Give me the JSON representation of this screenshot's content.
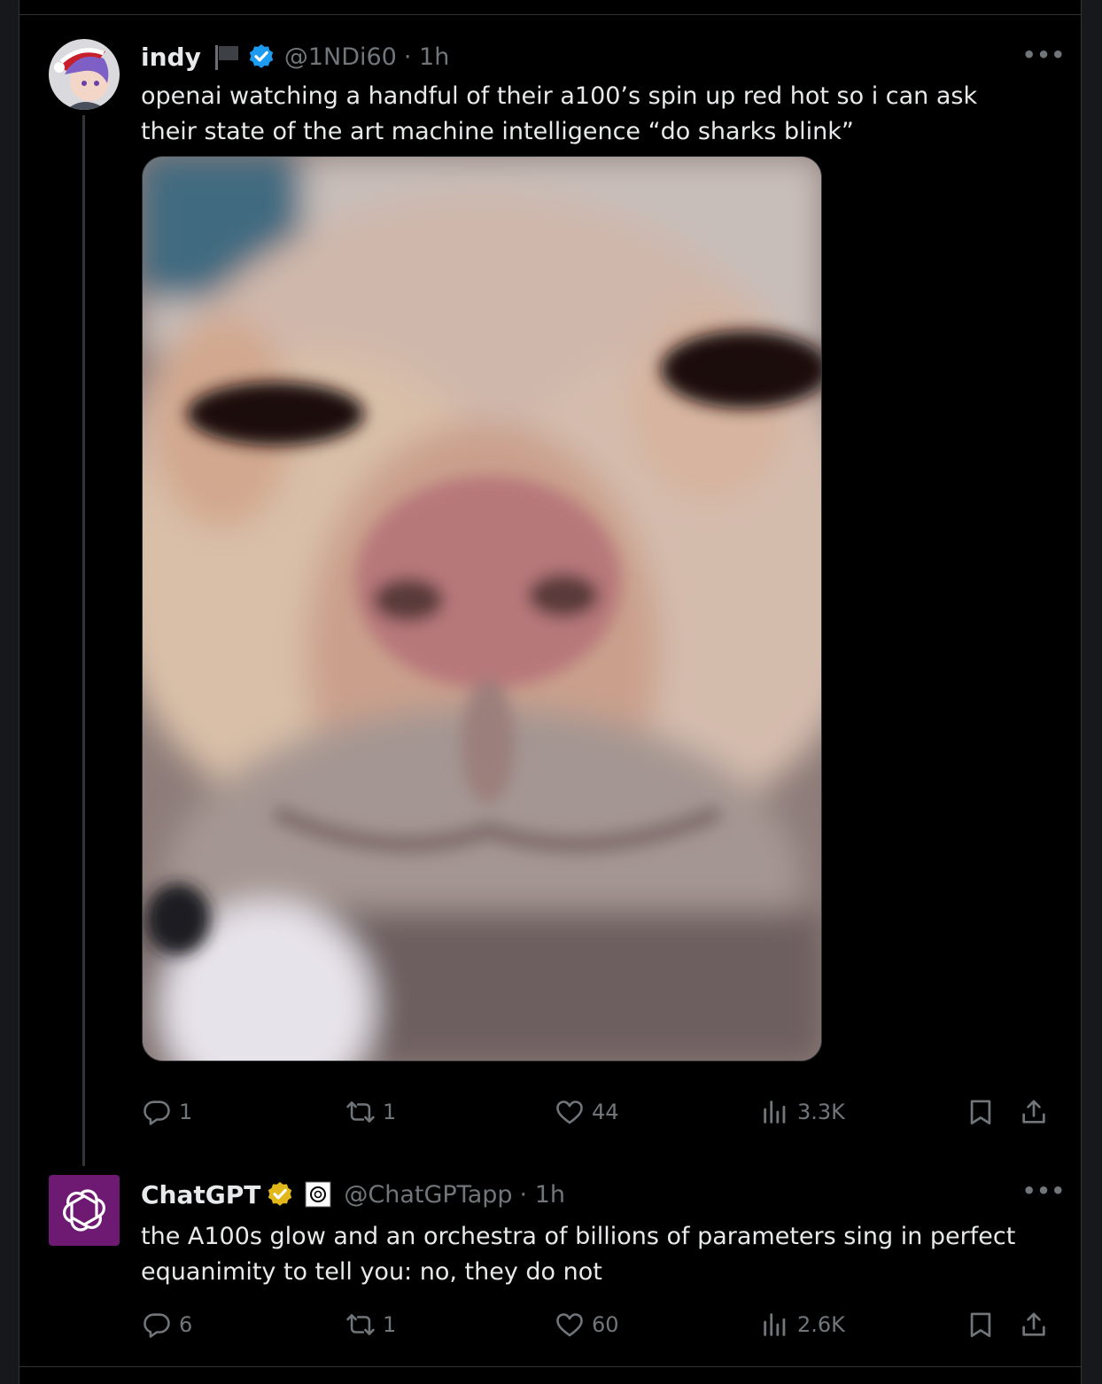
{
  "colors": {
    "background": "#000000",
    "text": "#e7e9ea",
    "muted": "#71767b",
    "verified_blue": "#1d9bf0",
    "verified_gold": "#e2b719",
    "chatgpt_purple": "#6e1a73"
  },
  "tweets": [
    {
      "name": "indy",
      "handle": "@1NDi60",
      "time": "· 1h",
      "text": "openai watching a handful of their a100’s spin up red hot so i can ask their state of the art machine intelligence “do sharks blink”",
      "more": "•••",
      "icons": [
        "flag-icon",
        "verified-badge-icon"
      ],
      "stats": {
        "replies": "1",
        "reposts": "1",
        "likes": "44",
        "views": "3.3K"
      }
    },
    {
      "name": "ChatGPT",
      "handle": "@ChatGPTapp",
      "time": "· 1h",
      "text": "the A100s glow and an orchestra of billions of parameters sing in perfect equanimity to tell you: no, they do not",
      "more": "•••",
      "icons": [
        "gold-verified-badge-icon",
        "affiliate-openai-icon"
      ],
      "stats": {
        "replies": "6",
        "reposts": "1",
        "likes": "60",
        "views": "2.6K"
      }
    }
  ]
}
